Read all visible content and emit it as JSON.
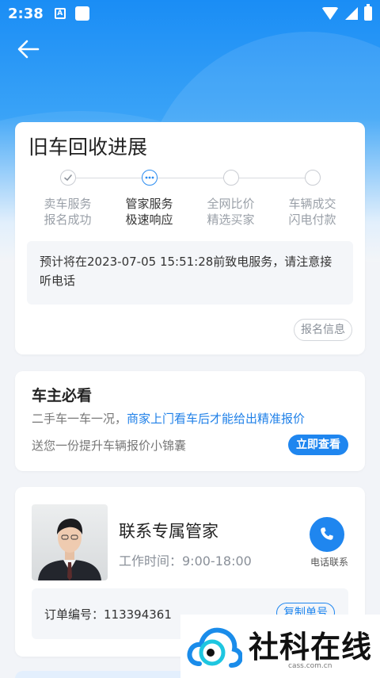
{
  "status_bar": {
    "time": "2:38",
    "indicator_letter": "A"
  },
  "header": {
    "back_icon": "arrow-left-icon"
  },
  "progress_card": {
    "title": "旧车回收进展",
    "steps": [
      {
        "line1": "卖车服务",
        "line2": "报名成功",
        "state": "done"
      },
      {
        "line1": "管家服务",
        "line2": "极速响应",
        "state": "active"
      },
      {
        "line1": "全网比价",
        "line2": "精选买家",
        "state": "pending"
      },
      {
        "line1": "车辆成交",
        "line2": "闪电付款",
        "state": "pending"
      }
    ],
    "notice": "预计将在2023-07-05 15:51:28前致电服务，请注意接听电话",
    "info_button": "报名信息"
  },
  "owner_card": {
    "heading": "车主必看",
    "line1_plain": "二手车一车一况，",
    "line1_highlight": "商家上门看车后才能给出精准报价",
    "line2": "送您一份提升车辆报价小锦囊",
    "action_button": "立即查看"
  },
  "butler_card": {
    "name": "联系专属管家",
    "hours": "工作时间：9:00-18:00",
    "call_label": "电话联系",
    "order_label": "订单编号：113394361",
    "copy_button": "复制单号"
  },
  "watermark": {
    "text": "社科在线",
    "sub": "cass.com.cn"
  },
  "colors": {
    "accent": "#1f86ef",
    "header_gradient_top": "#1a8df5"
  }
}
